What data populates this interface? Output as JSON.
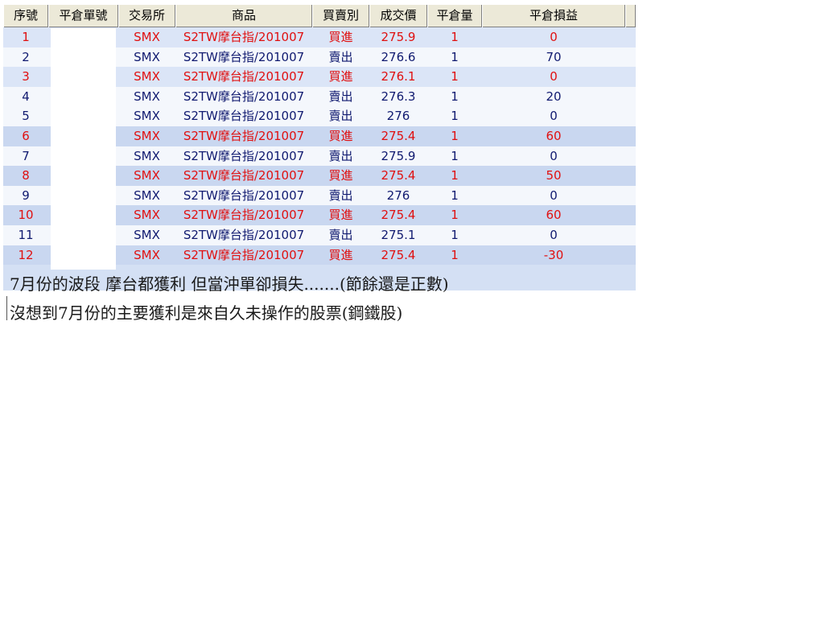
{
  "columns": [
    "序號",
    "平倉單號",
    "交易所",
    "商品",
    "買賣別",
    "成交價",
    "平倉量",
    "平倉損益"
  ],
  "rows": [
    {
      "seq": "1",
      "exchange": "SMX",
      "product": "S2TW摩台指/201007",
      "side": "買進",
      "price": "275.9",
      "qty": "1",
      "pnl": "0"
    },
    {
      "seq": "2",
      "exchange": "SMX",
      "product": "S2TW摩台指/201007",
      "side": "賣出",
      "price": "276.6",
      "qty": "1",
      "pnl": "70"
    },
    {
      "seq": "3",
      "exchange": "SMX",
      "product": "S2TW摩台指/201007",
      "side": "買進",
      "price": "276.1",
      "qty": "1",
      "pnl": "0"
    },
    {
      "seq": "4",
      "exchange": "SMX",
      "product": "S2TW摩台指/201007",
      "side": "賣出",
      "price": "276.3",
      "qty": "1",
      "pnl": "20"
    },
    {
      "seq": "5",
      "exchange": "SMX",
      "product": "S2TW摩台指/201007",
      "side": "賣出",
      "price": "276",
      "qty": "1",
      "pnl": "0"
    },
    {
      "seq": "6",
      "exchange": "SMX",
      "product": "S2TW摩台指/201007",
      "side": "買進",
      "price": "275.4",
      "qty": "1",
      "pnl": "60"
    },
    {
      "seq": "7",
      "exchange": "SMX",
      "product": "S2TW摩台指/201007",
      "side": "賣出",
      "price": "275.9",
      "qty": "1",
      "pnl": "0"
    },
    {
      "seq": "8",
      "exchange": "SMX",
      "product": "S2TW摩台指/201007",
      "side": "買進",
      "price": "275.4",
      "qty": "1",
      "pnl": "50"
    },
    {
      "seq": "9",
      "exchange": "SMX",
      "product": "S2TW摩台指/201007",
      "side": "賣出",
      "price": "276",
      "qty": "1",
      "pnl": "0"
    },
    {
      "seq": "10",
      "exchange": "SMX",
      "product": "S2TW摩台指/201007",
      "side": "買進",
      "price": "275.4",
      "qty": "1",
      "pnl": "60"
    },
    {
      "seq": "11",
      "exchange": "SMX",
      "product": "S2TW摩台指/201007",
      "side": "賣出",
      "price": "275.1",
      "qty": "1",
      "pnl": "0"
    },
    {
      "seq": "12",
      "exchange": "SMX",
      "product": "S2TW摩台指/201007",
      "side": "買進",
      "price": "275.4",
      "qty": "1",
      "pnl": "-30"
    }
  ],
  "notes": [
    "7月份的波段  摩台都獲利  但當沖單卻損失.......(節餘還是正數)",
    "沒想到7月份的主要獲利是來自久未操作的股票(鋼鐵股)"
  ],
  "colors": {
    "buy": "#e01010",
    "sell": "#101a70"
  }
}
